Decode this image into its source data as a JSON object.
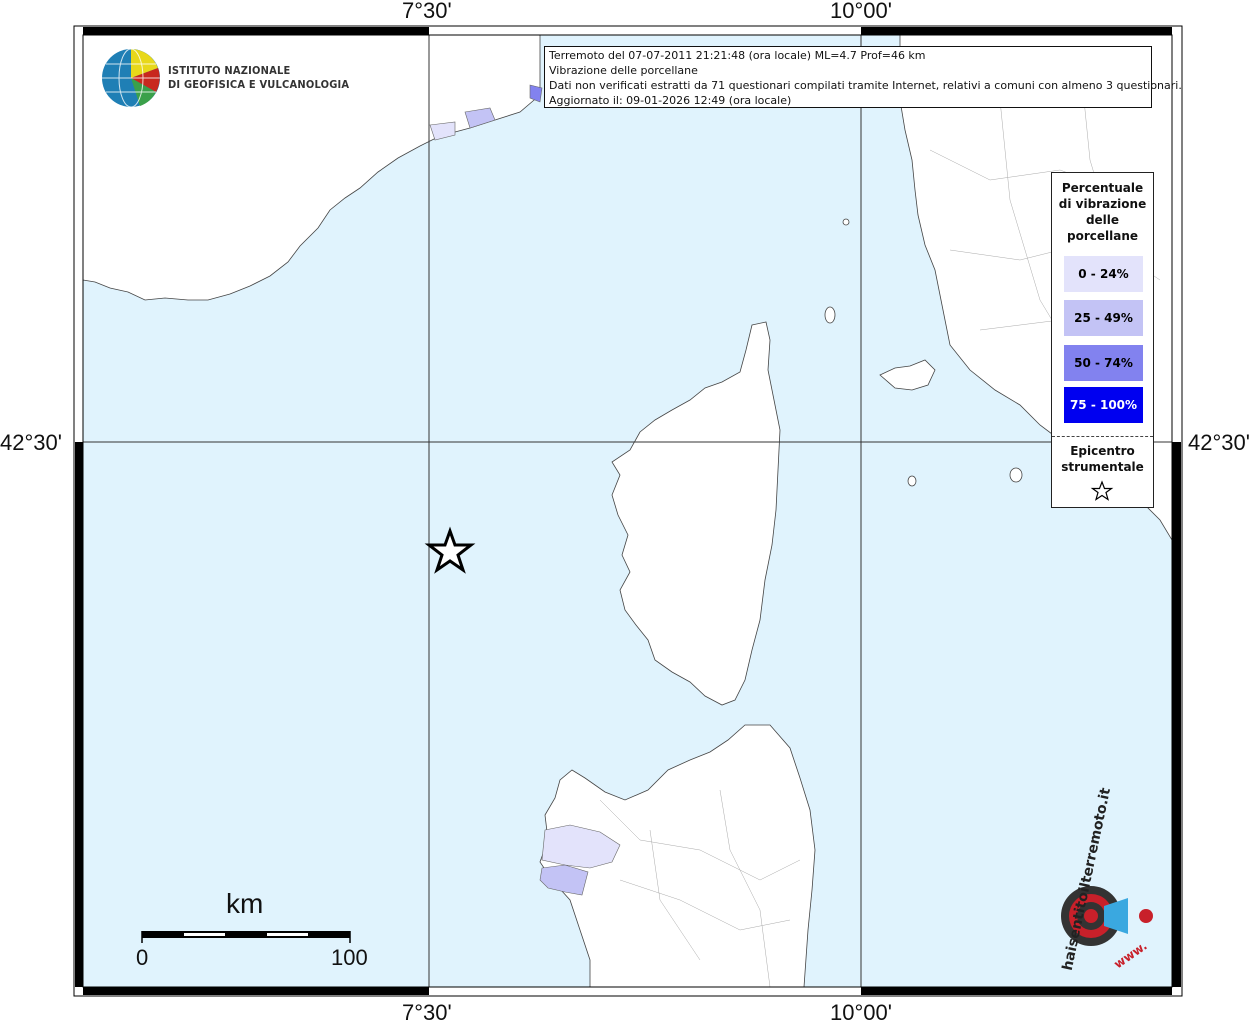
{
  "map": {
    "coordinate_labels": {
      "top_left": "7°30'",
      "top_right": "10°00'",
      "bottom_left": "7°30'",
      "bottom_right": "10°00'",
      "left_lat": "42°30'",
      "right_lat": "42°30'"
    },
    "colors": {
      "sea": "#e0f3fd",
      "land": "#ffffff",
      "boundaries": "#888888",
      "frame": "#000000"
    }
  },
  "institute": {
    "line1": "ISTITUTO NAZIONALE",
    "line2": "DI GEOFISICA E VULCANOLOGIA",
    "icon": "globe-logo-icon"
  },
  "info_box": {
    "line1": "Terremoto del 07-07-2011 21:21:48 (ora locale) ML=4.7 Prof=46 km",
    "line2": "Vibrazione delle porcellane",
    "line3": "Dati non verificati estratti da 71 questionari compilati tramite Internet, relativi a comuni con almeno 3 questionari.",
    "line4": "Aggiornato il: 09-01-2026 12:49 (ora locale)"
  },
  "legend": {
    "title": "Percentuale di vibrazione delle porcellane",
    "classes": [
      {
        "label": "0 - 24%",
        "color": "#e3e3fb",
        "text_color": "#000000"
      },
      {
        "label": "25 - 49%",
        "color": "#c3c3f5",
        "text_color": "#000000"
      },
      {
        "label": "50 - 74%",
        "color": "#8282ef",
        "text_color": "#000000"
      },
      {
        "label": "75 - 100%",
        "color": "#0000f0",
        "text_color": "#ffffff"
      }
    ],
    "epicenter_title": "Epicentro strumentale",
    "epicenter_icon": "star-icon"
  },
  "scale_bar": {
    "unit": "km",
    "min_label": "0",
    "max_label": "100"
  },
  "site_logo": {
    "text": "haisentitoilterremoto.it",
    "url_text": "www.",
    "icon": "loudspeaker-icon"
  }
}
